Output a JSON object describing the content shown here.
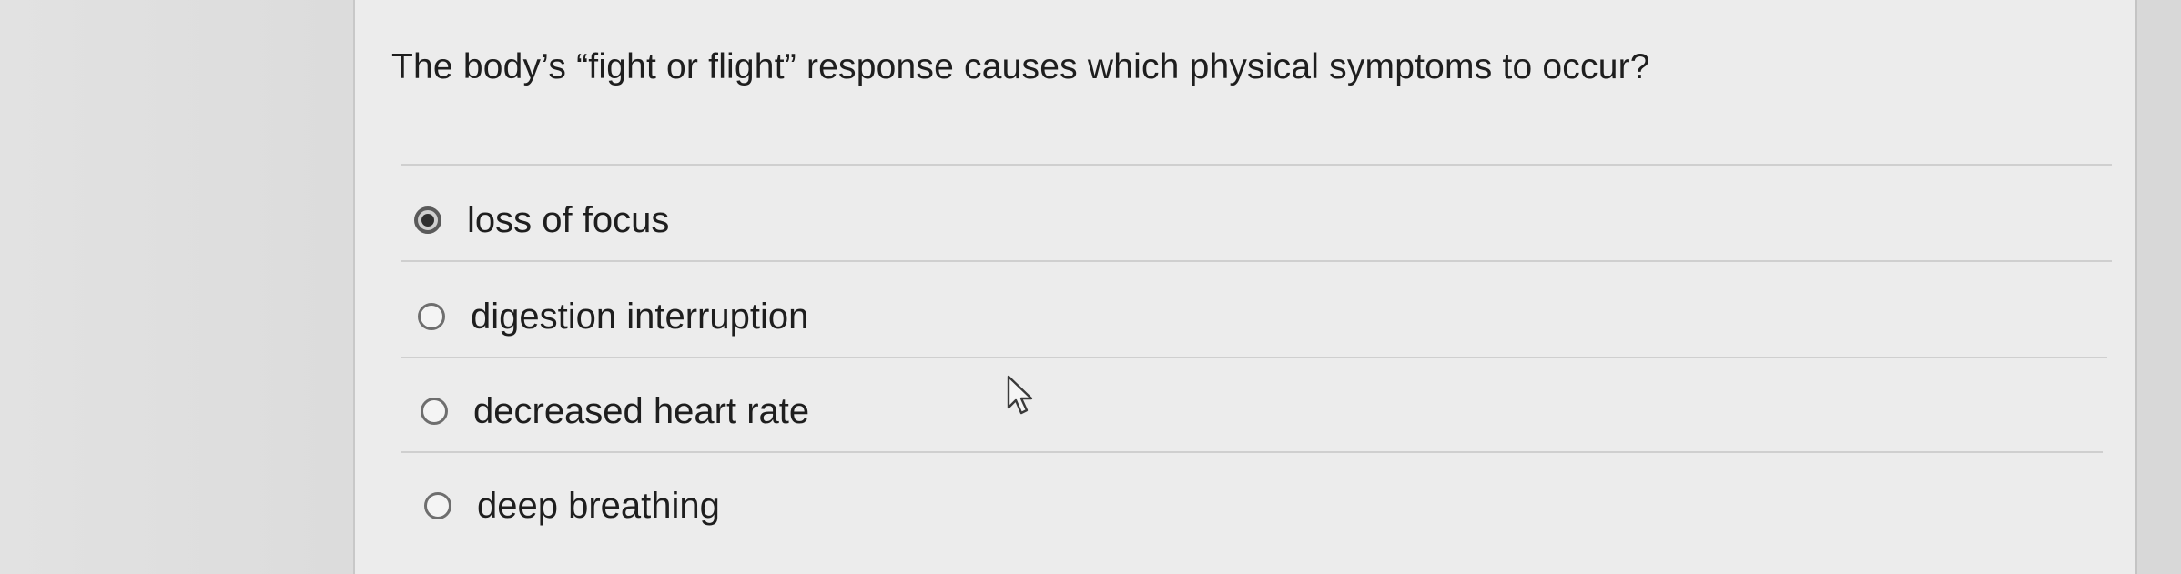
{
  "question": {
    "text": "The body’s “fight or flight” response causes which physical symptoms to occur?"
  },
  "options": [
    {
      "label": "loss of focus",
      "selected": true
    },
    {
      "label": "digestion interruption",
      "selected": false
    },
    {
      "label": "decreased heart rate",
      "selected": false
    },
    {
      "label": "deep breathing",
      "selected": false
    }
  ],
  "icons": {
    "cursor": "mouse-pointer-arrow-icon",
    "radio_selected": "radio-selected-icon",
    "radio_unselected": "radio-unselected-icon"
  }
}
